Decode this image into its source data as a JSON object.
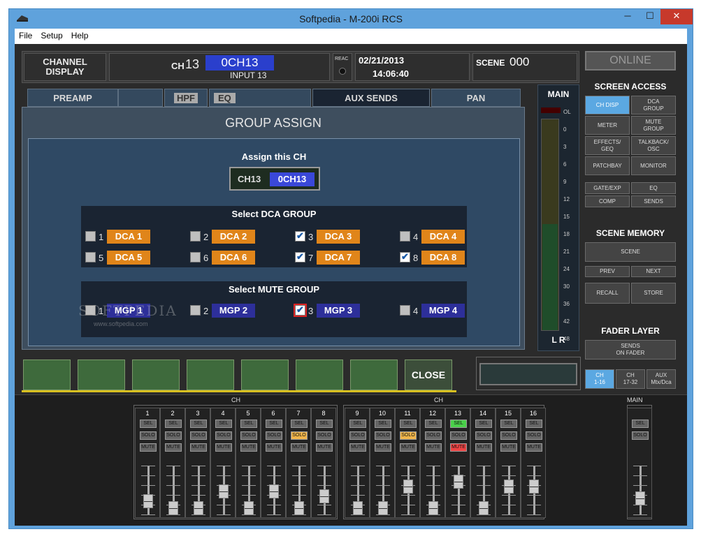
{
  "window": {
    "title": "Softpedia - M-200i RCS"
  },
  "menu": [
    "File",
    "Setup",
    "Help"
  ],
  "header": {
    "channel_display": "CHANNEL\nDISPLAY",
    "ch_label": "CH",
    "ch_num": "13",
    "ch_name": "0CH13",
    "input": "INPUT 13",
    "reac": "REAC",
    "date": "02/21/2013",
    "time": "14:06:40",
    "scene_label": "SCENE",
    "scene_num": "000"
  },
  "tabs": {
    "preamp": "PREAMP",
    "hpf": "HPF",
    "eq": "EQ",
    "aux": "AUX SENDS",
    "pan": "PAN",
    "ol": "OL"
  },
  "main_meter": {
    "title": "MAIN",
    "scale": [
      "OL",
      "0",
      "3",
      "6",
      "9",
      "12",
      "15",
      "18",
      "21",
      "24",
      "30",
      "36",
      "42",
      "48"
    ],
    "lr": "L R"
  },
  "dialog": {
    "title": "GROUP ASSIGN",
    "assign_label": "Assign this CH",
    "ch": "CH13",
    "ch_name": "0CH13",
    "dca_title": "Select DCA GROUP",
    "mute_title": "Select MUTE GROUP",
    "dca": [
      {
        "num": "1",
        "label": "DCA 1",
        "checked": false
      },
      {
        "num": "2",
        "label": "DCA 2",
        "checked": false
      },
      {
        "num": "3",
        "label": "DCA 3",
        "checked": true
      },
      {
        "num": "4",
        "label": "DCA 4",
        "checked": false
      },
      {
        "num": "5",
        "label": "DCA 5",
        "checked": false
      },
      {
        "num": "6",
        "label": "DCA 6",
        "checked": false
      },
      {
        "num": "7",
        "label": "DCA 7",
        "checked": true
      },
      {
        "num": "8",
        "label": "DCA 8",
        "checked": true
      }
    ],
    "mgp": [
      {
        "num": "1",
        "label": "MGP 1",
        "checked": false
      },
      {
        "num": "2",
        "label": "MGP 2",
        "checked": false
      },
      {
        "num": "3",
        "label": "MGP 3",
        "checked": true
      },
      {
        "num": "4",
        "label": "MGP 4",
        "checked": false
      }
    ],
    "watermark": "SOFTPEDIA",
    "watermark_url": "www.softpedia.com"
  },
  "softkeys": {
    "close": "CLOSE"
  },
  "right_panel": {
    "online": "ONLINE",
    "screen_access": "SCREEN ACCESS",
    "buttons": [
      "CH DISP",
      "DCA\nGROUP",
      "METER",
      "MUTE\nGROUP",
      "EFFECTS/\nGEQ",
      "TALKBACK/\nOSC",
      "PATCHBAY",
      "MONITOR",
      "GATE/EXP",
      "EQ",
      "COMP",
      "SENDS"
    ],
    "scene_memory": "SCENE MEMORY",
    "scene": "SCENE",
    "prev": "PREV",
    "next": "NEXT",
    "recall": "RECALL",
    "store": "STORE",
    "fader_layer": "FADER LAYER",
    "sends_on_fader": "SENDS\nON FADER",
    "layers": [
      "CH\n1-16",
      "CH\n17-32",
      "AUX\nMtx/Dca"
    ]
  },
  "strips": {
    "bank_label": "CH",
    "main_label": "MAIN",
    "sel": "SEL",
    "solo": "SOLO",
    "mute": "MUTE",
    "channels": [
      {
        "num": "1",
        "solo_on": false,
        "sel_on": false,
        "mute_on": false,
        "level": 0.25
      },
      {
        "num": "2",
        "solo_on": false,
        "sel_on": false,
        "mute_on": false,
        "level": 0.1
      },
      {
        "num": "3",
        "solo_on": false,
        "sel_on": false,
        "mute_on": false,
        "level": 0.1
      },
      {
        "num": "4",
        "solo_on": false,
        "sel_on": false,
        "mute_on": false,
        "level": 0.45
      },
      {
        "num": "5",
        "solo_on": false,
        "sel_on": false,
        "mute_on": false,
        "level": 0.1
      },
      {
        "num": "6",
        "solo_on": false,
        "sel_on": false,
        "mute_on": false,
        "level": 0.45
      },
      {
        "num": "7",
        "solo_on": true,
        "sel_on": false,
        "mute_on": false,
        "level": 0.1
      },
      {
        "num": "8",
        "solo_on": false,
        "sel_on": false,
        "mute_on": false,
        "level": 0.35
      },
      {
        "num": "9",
        "solo_on": false,
        "sel_on": false,
        "mute_on": false,
        "level": 0.1
      },
      {
        "num": "10",
        "solo_on": false,
        "sel_on": false,
        "mute_on": false,
        "level": 0.1
      },
      {
        "num": "11",
        "solo_on": true,
        "sel_on": false,
        "mute_on": false,
        "level": 0.55
      },
      {
        "num": "12",
        "solo_on": false,
        "sel_on": false,
        "mute_on": false,
        "level": 0.1
      },
      {
        "num": "13",
        "solo_on": false,
        "sel_on": true,
        "mute_on": true,
        "level": 0.65
      },
      {
        "num": "14",
        "solo_on": false,
        "sel_on": false,
        "mute_on": false,
        "level": 0.1
      },
      {
        "num": "15",
        "solo_on": false,
        "sel_on": false,
        "mute_on": false,
        "level": 0.55
      },
      {
        "num": "16",
        "solo_on": false,
        "sel_on": false,
        "mute_on": false,
        "level": 0.55
      }
    ],
    "main_level": 0.3
  }
}
